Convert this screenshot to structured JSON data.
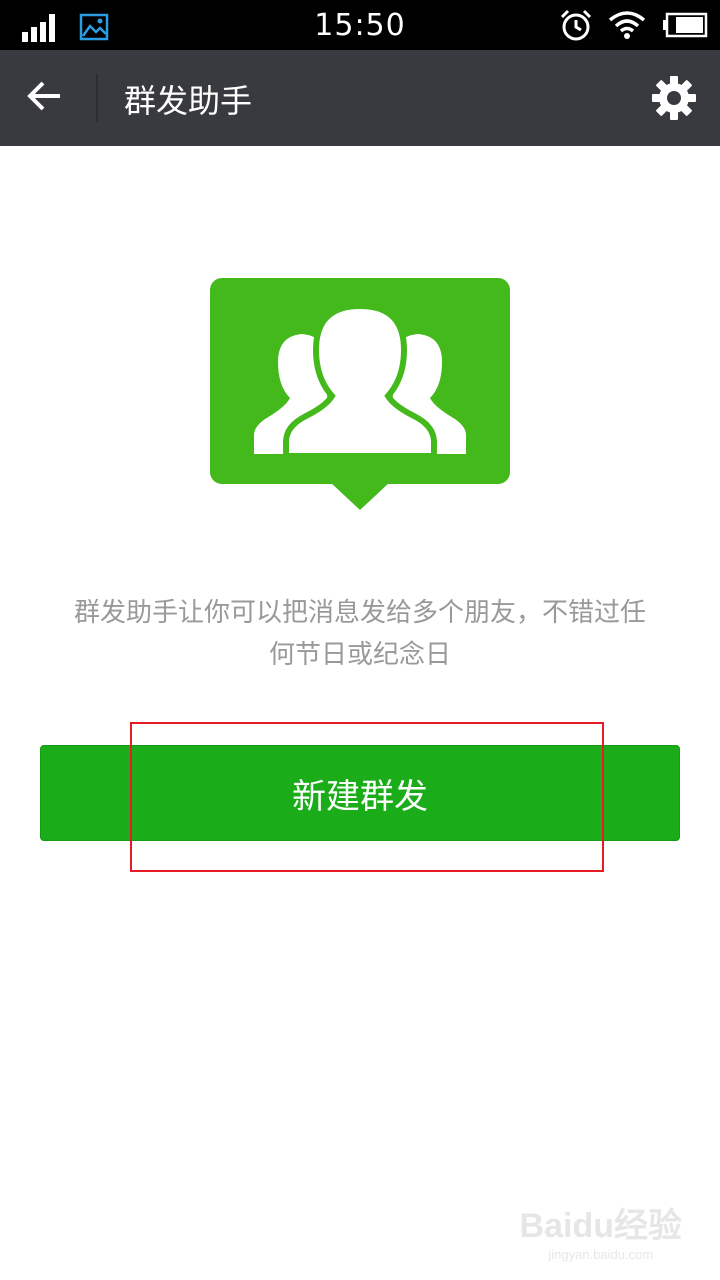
{
  "status_bar": {
    "time": "15:50",
    "left_icons": [
      "signal-icon",
      "gallery-notification-icon"
    ],
    "right_icons": [
      "alarm-icon",
      "wifi-icon",
      "battery-icon"
    ]
  },
  "title_bar": {
    "title": "群发助手",
    "back_icon": "back-arrow-icon",
    "settings_icon": "gear-icon"
  },
  "hero": {
    "icon": "group-chat-icon",
    "color": "#44b91c"
  },
  "description": {
    "line1": "群发助手让你可以把消息发给多个朋友，不错过任",
    "line2": "何节日或纪念日"
  },
  "new_broadcast_button": {
    "label": "新建群发",
    "color": "#1aad19"
  },
  "watermark": {
    "logo": "Baidu经验",
    "url": "jingyan.baidu.com"
  },
  "colors": {
    "status_bar_bg": "#000000",
    "title_bar_bg": "#393a3f",
    "highlight_box": "#e51c23",
    "description_text": "#999999"
  }
}
